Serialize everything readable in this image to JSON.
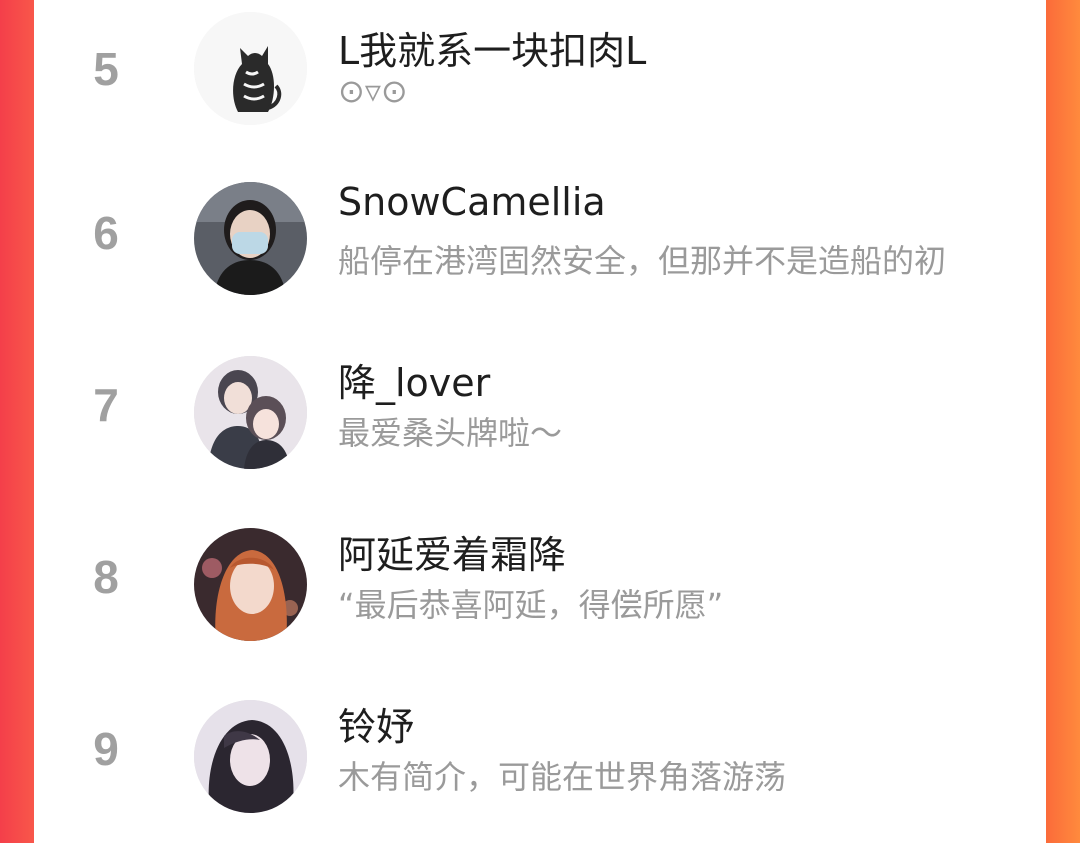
{
  "ranking": {
    "items": [
      {
        "rank": "5",
        "name": "L我就系一块扣肉L",
        "bio": "⊙▿⊙",
        "avatar": "cat-avatar"
      },
      {
        "rank": "6",
        "name": "SnowCamellia",
        "bio": "船停在港湾固然安全，但那并不是造船的初",
        "avatar": "masked-girl-avatar"
      },
      {
        "rank": "7",
        "name": "降_lover",
        "bio": "最爱桑头牌啦～",
        "avatar": "anime-couple-avatar"
      },
      {
        "rank": "8",
        "name": "阿延爱着霜降",
        "bio": "“最后恭喜阿延，得偿所愿”",
        "avatar": "anime-redhead-avatar"
      },
      {
        "rank": "9",
        "name": "铃妤",
        "bio": "木有简介，可能在世界角落游荡",
        "avatar": "anime-darkhair-avatar"
      }
    ]
  },
  "colors": {
    "left_edge": "#f43f4a",
    "right_edge": "#ff8a3d",
    "rank": "#a0a0a0",
    "name": "#1e1e1e",
    "bio": "#9a9a9a"
  }
}
